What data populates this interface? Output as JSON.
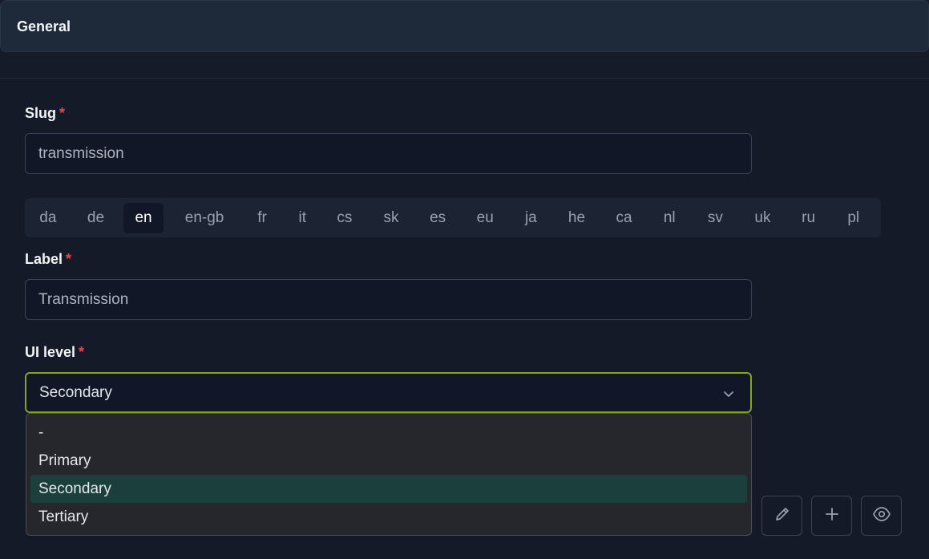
{
  "header": {
    "title": "General"
  },
  "slug": {
    "label": "Slug",
    "required_mark": "*",
    "value": "transmission"
  },
  "languages": {
    "tabs": [
      "da",
      "de",
      "en",
      "en-gb",
      "fr",
      "it",
      "cs",
      "sk",
      "es",
      "eu",
      "ja",
      "he",
      "ca",
      "nl",
      "sv",
      "uk",
      "ru",
      "pl"
    ],
    "active": "en"
  },
  "label_field": {
    "label": "Label",
    "required_mark": "*",
    "value": "Transmission"
  },
  "ui_level": {
    "label": "UI level",
    "required_mark": "*",
    "selected": "Secondary",
    "options": [
      "-",
      "Primary",
      "Secondary",
      "Tertiary"
    ]
  },
  "actions": {
    "icons": [
      "pencil-icon",
      "plus-icon",
      "eye-icon"
    ]
  },
  "colors": {
    "focus_border": "#84a61f",
    "selected_option": "#1b3f3d",
    "required": "#ef4444"
  }
}
